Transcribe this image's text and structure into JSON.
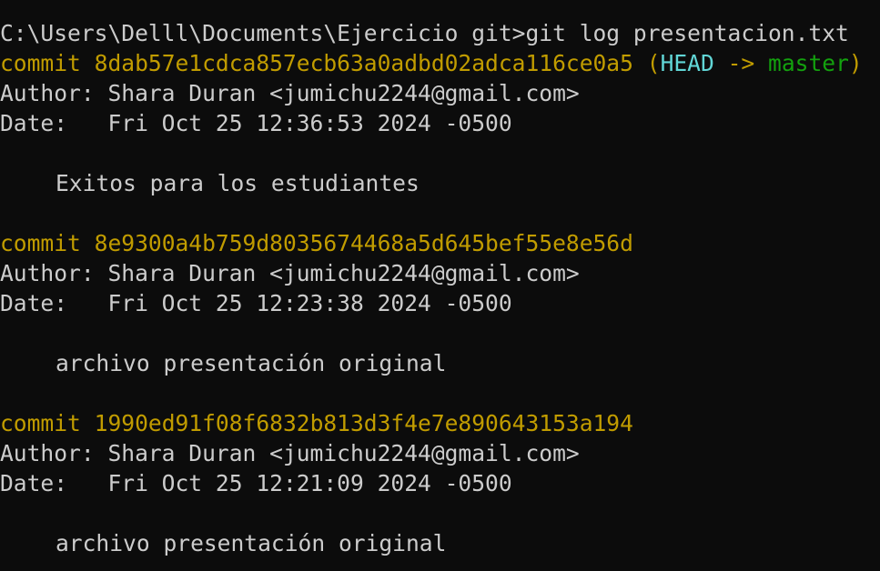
{
  "terminal": {
    "prompt_line": "C:\\Users\\Delll\\Documents\\Ejercicio git>git log presentacion.txt",
    "commits": [
      {
        "commit_label": "commit",
        "hash": "8dab57e1cdca857ecb63a0adbd02adca116ce0a5",
        "head_label": "HEAD",
        "arrow": "->",
        "branch": "master",
        "author_line": "Author: Shara Duran <jumichu2244@gmail.com>",
        "date_line": "Date:   Fri Oct 25 12:36:53 2024 -0500",
        "message": "Exitos para los estudiantes"
      },
      {
        "commit_label": "commit",
        "hash": "8e9300a4b759d8035674468a5d645bef55e8e56d",
        "author_line": "Author: Shara Duran <jumichu2244@gmail.com>",
        "date_line": "Date:   Fri Oct 25 12:23:38 2024 -0500",
        "message": "archivo presentación original"
      },
      {
        "commit_label": "commit",
        "hash": "1990ed91f08f6832b813d3f4e7e890643153a194",
        "author_line": "Author: Shara Duran <jumichu2244@gmail.com>",
        "date_line": "Date:   Fri Oct 25 12:21:09 2024 -0500",
        "message": "archivo presentación original"
      }
    ],
    "colors": {
      "background": "#0c0c0c",
      "text": "#cccccc",
      "commit_yellow": "#c19c00",
      "head_cyan": "#61d6d6",
      "branch_green": "#13a10e"
    }
  }
}
